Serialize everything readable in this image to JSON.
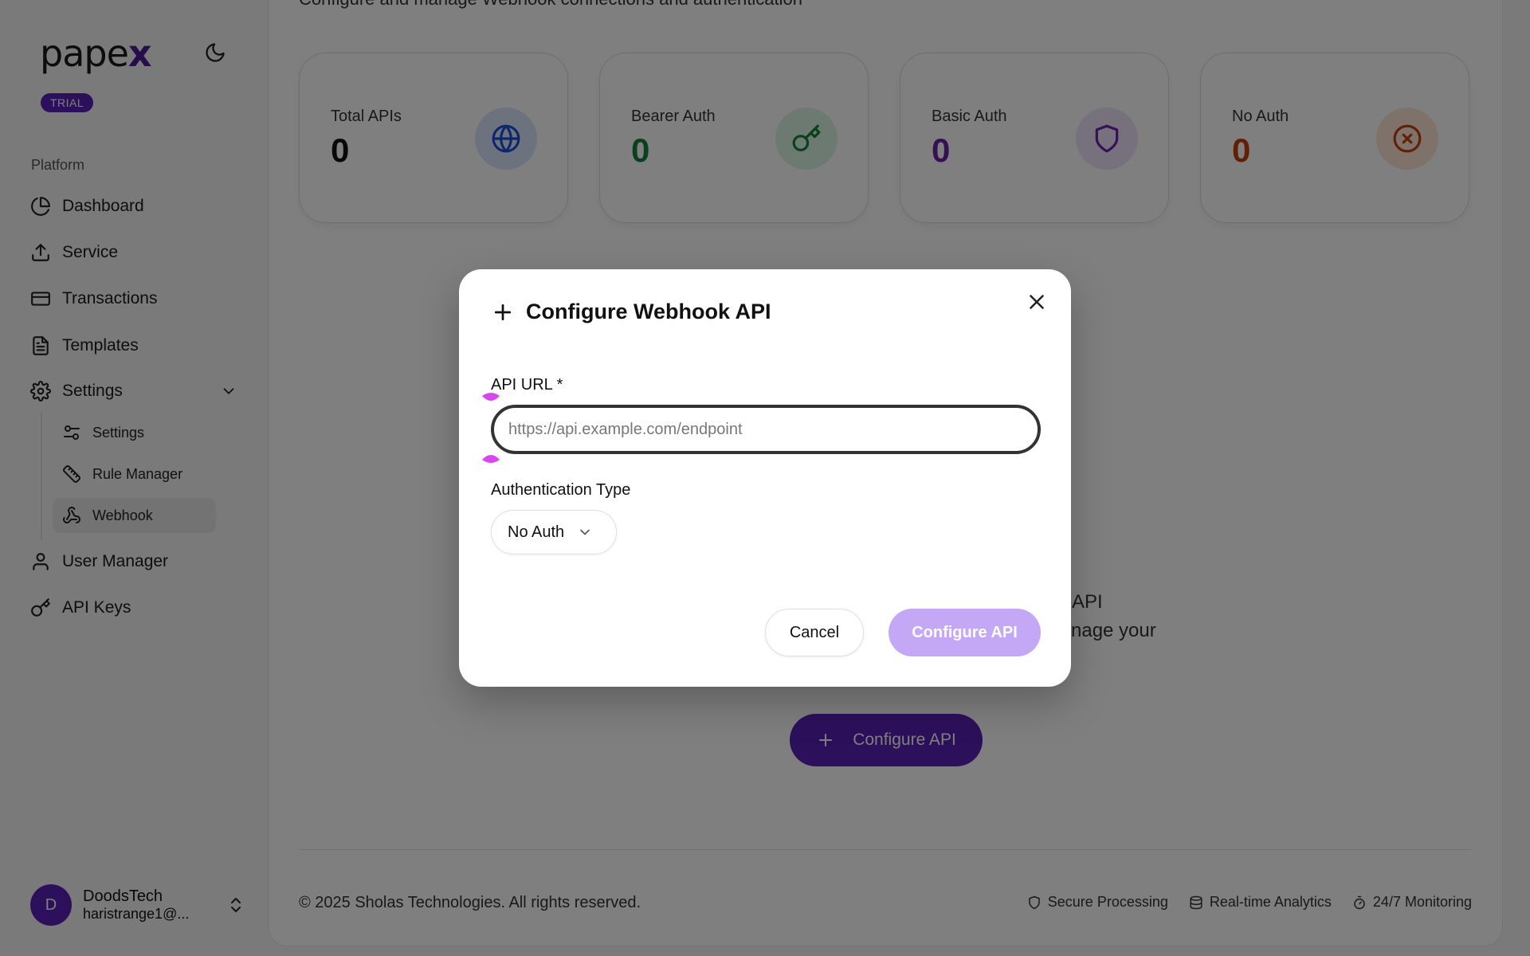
{
  "sidebar": {
    "logo_main": "pape",
    "logo_x": "x",
    "badge": "TRIAL",
    "section": "Platform",
    "items": [
      {
        "label": "Dashboard"
      },
      {
        "label": "Service"
      },
      {
        "label": "Transactions"
      },
      {
        "label": "Templates"
      },
      {
        "label": "Settings"
      },
      {
        "label": "User Manager"
      },
      {
        "label": "API Keys"
      }
    ],
    "sub_items": [
      {
        "label": "Settings"
      },
      {
        "label": "Rule Manager"
      },
      {
        "label": "Webhook"
      }
    ],
    "user": {
      "initial": "D",
      "name": "DoodsTech",
      "email": "haristrange1@..."
    }
  },
  "main": {
    "subtitle": "Configure and manage Webhook connections and authentication",
    "stats": [
      {
        "label": "Total APIs",
        "value": "0",
        "color": "#111111",
        "icon": "globe-icon",
        "icon_color": "#1d4ed8",
        "bg": "#dbe7fd"
      },
      {
        "label": "Bearer Auth",
        "value": "0",
        "color": "#15803d",
        "icon": "key-icon",
        "icon_color": "#15803d",
        "bg": "#d9f5e2"
      },
      {
        "label": "Basic Auth",
        "value": "0",
        "color": "#6b21a8",
        "icon": "shield-icon",
        "icon_color": "#6b21a8",
        "bg": "#efe3fb"
      },
      {
        "label": "No Auth",
        "value": "0",
        "color": "#c2410c",
        "icon": "x-circle-icon",
        "icon_color": "#c2410c",
        "bg": "#fde4d4"
      }
    ],
    "empty_line1": "API",
    "empty_line2": "nage your",
    "cta_label": "Configure API",
    "footer": {
      "copyright": "© 2025 Sholas Technologies. All rights reserved.",
      "features": [
        "Secure Processing",
        "Real-time Analytics",
        "24/7 Monitoring"
      ]
    }
  },
  "modal": {
    "title": "Configure Webhook API",
    "url_label": "API URL *",
    "url_value": "",
    "url_placeholder": "https://api.example.com/endpoint",
    "auth_label": "Authentication Type",
    "auth_selected": "No Auth",
    "cancel_label": "Cancel",
    "submit_label": "Configure API"
  },
  "colors": {
    "brand": "#5b21b6",
    "submit_disabled": "#c4a7f5",
    "handle": "#d946ef"
  }
}
